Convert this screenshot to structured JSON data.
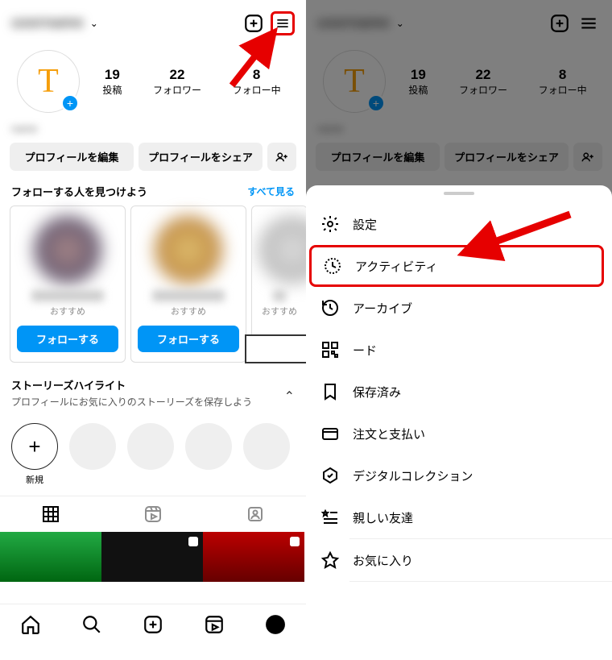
{
  "left": {
    "username_blur": "username",
    "stats": {
      "posts_n": "19",
      "posts_l": "投稿",
      "followers_n": "22",
      "followers_l": "フォロワー",
      "following_n": "8",
      "following_l": "フォロー中"
    },
    "avatar_letter": "T",
    "display_name_blur": "name",
    "edit_profile": "プロフィールを編集",
    "share_profile": "プロフィールをシェア",
    "discover_title": "フォローする人を見つけよう",
    "see_all": "すべて見る",
    "card_sub": "おすすめ",
    "follow": "フォローする",
    "hl_title": "ストーリーズハイライト",
    "hl_sub": "プロフィールにお気に入りのストーリーズを保存しよう",
    "hl_new": "新規"
  },
  "menu": {
    "settings": "設定",
    "activity": "アクティビティ",
    "archive": "アーカイブ",
    "qr": "ード",
    "saved": "保存済み",
    "orders": "注文と支払い",
    "digital": "デジタルコレクション",
    "close_friends": "親しい友達",
    "favorites": "お気に入り"
  }
}
